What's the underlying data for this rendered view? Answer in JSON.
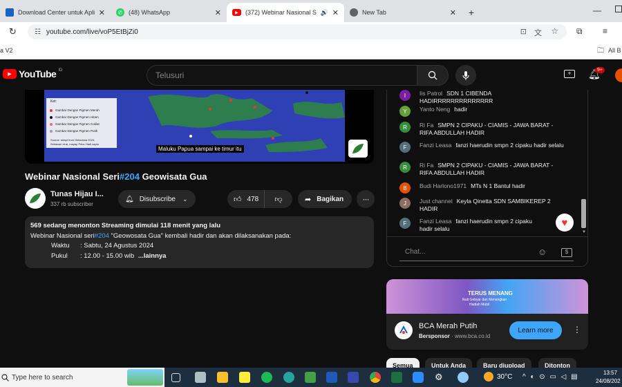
{
  "browser": {
    "tabs": [
      {
        "title": "Download Center untuk Aplik",
        "favicon_color": "#1565c0"
      },
      {
        "title": "(48) WhatsApp",
        "favicon_color": "#25d366"
      },
      {
        "title": "(372) Webinar Nasional Ser",
        "favicon_color": "#ff0000"
      },
      {
        "title": "New Tab",
        "favicon_color": "#5f6368"
      }
    ],
    "url": "youtube.com/live/voP5EtBjZi0",
    "bookmark_left": "a V2",
    "bookmark_right": "All B"
  },
  "youtube": {
    "logo": "YouTube",
    "country_code": "ID",
    "search_placeholder": "Telusuri",
    "notification_badge": "9+"
  },
  "video": {
    "overlay_caption": "Maluku Papua sampai ke timur itu",
    "legend_title": "Ket:",
    "legend_items": [
      "Gambar Dengan Pigmen Merah",
      "Gambar Dengan Pigmen Hitam",
      "Gambar Dengan Pigmen Coklat",
      "Gambar Dengan Pigmen Putih"
    ],
    "source_line1": "Source: adapt from Oktaviana 2024,",
    "source_line2": "Setiawan et.al, mayap   Peta: Hadi sapto",
    "title_prefix": "Webinar Nasional Seri",
    "title_tag": "#204",
    "title_suffix": " Geowisata Gua"
  },
  "channel": {
    "name": "Tunas Hijau I...",
    "subscribers": "337 rb subscriber",
    "subscribe_label": "Disubscribe",
    "likes": "478",
    "share_label": "Bagikan"
  },
  "description": {
    "stats": "569 sedang menonton  Streaming dimulai 118 menit yang lalu",
    "line1_prefix": "Webinar Nasional seri",
    "line1_tag": "#204",
    "line1_suffix": " \"Geowosata Gua\" kembali hadir dan akan dilaksanakan pada:",
    "waktu_label": "Waktu",
    "waktu_value": ": Sabtu, 24 Agustus 2024",
    "pukul_label": "Pukul",
    "pukul_value": ": 12.00 - 15.00 wib",
    "more": "...lainnya"
  },
  "chat": {
    "messages": [
      {
        "initial": "I",
        "color": "#7b1fa2",
        "author": "Iis Patrol",
        "text": "SDN 1 CIBENDA HADIRRRRRRRRRRRRRR"
      },
      {
        "initial": "Y",
        "color": "#689f38",
        "author": "Yanto Neng",
        "text": "hadir"
      },
      {
        "initial": "R",
        "color": "#388e3c",
        "author": "Ri Fa",
        "text": "SMPN 2 CIPAKU - CIAMIS - JAWA BARAT - RIFA ABDULLAH HADIR"
      },
      {
        "initial": "F",
        "color": "#546e7a",
        "author": "Fanzi Leasa",
        "text": "fanzi haerudin smpn 2 cipaku hadir selalu"
      },
      {
        "initial": "R",
        "color": "#388e3c",
        "author": "Ri Fa",
        "text": "SMPN 2 CIPAKU - CIAMIS - JAWA BARAT - RIFA ABDULLAH HADIR"
      },
      {
        "initial": "B",
        "color": "#e65100",
        "author": "Budi Harlono1971",
        "text": "MTs N 1 Bantul hadir"
      },
      {
        "initial": "J",
        "color": "#8d6e63",
        "author": "Just channel",
        "text": "Keyla Qinetta SDN SAMBIKEREP 2 HADIR"
      },
      {
        "initial": "F",
        "color": "#546e7a",
        "author": "Fanzi Leasa",
        "text": "fanzi haerudin smpn 2 cipaku hadir selalu"
      }
    ],
    "input_placeholder": "Chat..."
  },
  "ad": {
    "banner_heading": "TERUS MENANG",
    "banner_sub": "Ikuti Gebyar dan Menangkan",
    "banner_sub2": "Hadiah Mobil",
    "advertiser": "BCA Merah Putih",
    "sponsored": "Bersponsor",
    "domain": "www.bca.co.id",
    "cta": "Learn more"
  },
  "chips": [
    "Semua",
    "Untuk Anda",
    "Baru diupload",
    "Ditonton"
  ],
  "taskbar": {
    "search_placeholder": "Type here to search",
    "temperature": "30°C",
    "time": "13:57",
    "date": "24/08/202"
  }
}
